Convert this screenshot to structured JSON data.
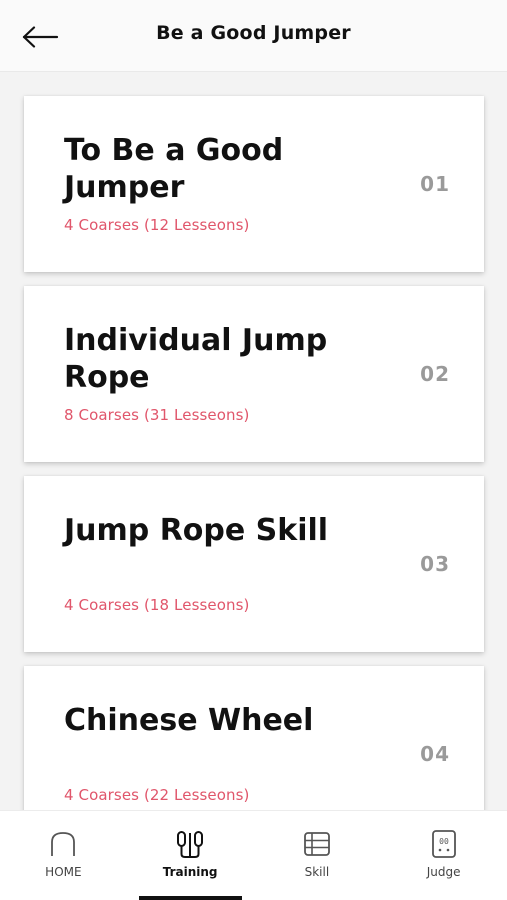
{
  "header": {
    "title": "Be a Good Jumper",
    "back_icon": "arrow-left-icon"
  },
  "courses": [
    {
      "title": "To Be a Good Jumper",
      "subtitle": "4 Coarses (12 Lesseons)",
      "number": "01"
    },
    {
      "title": "Individual Jump Rope",
      "subtitle": "8 Coarses (31 Lesseons)",
      "number": "02"
    },
    {
      "title": "Jump Rope Skill",
      "subtitle": "4 Coarses (18 Lesseons)",
      "number": "03"
    },
    {
      "title": "Chinese Wheel",
      "subtitle": "4 Coarses (22 Lesseons)",
      "number": "04"
    }
  ],
  "tabs": [
    {
      "label": "HOME",
      "icon": "home-icon",
      "active": false
    },
    {
      "label": "Training",
      "icon": "jump-rope-icon",
      "active": true
    },
    {
      "label": "Skill",
      "icon": "list-icon",
      "active": false
    },
    {
      "label": "Judge",
      "icon": "counter-icon",
      "active": false
    }
  ],
  "colors": {
    "accent_subtitle": "#e0566b",
    "number_gray": "#9a9a9a",
    "active_indicator": "#111111"
  }
}
